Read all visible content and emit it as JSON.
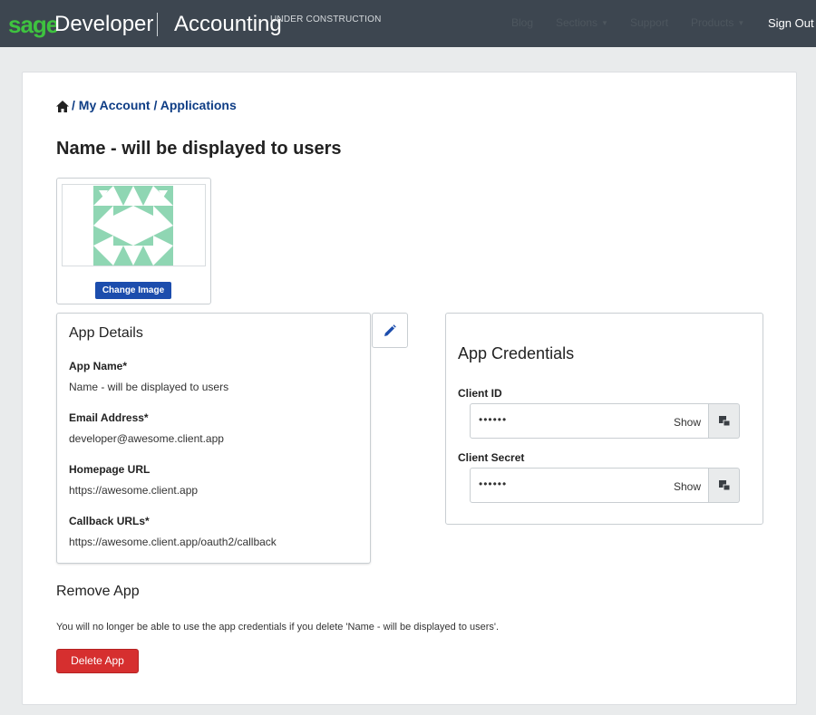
{
  "header": {
    "logo_sage": "sage",
    "logo_developer": "Developer",
    "logo_product": "Accounting",
    "logo_status": "UNDER CONSTRUCTION",
    "nav": {
      "blog": "Blog",
      "sections": "Sections",
      "support": "Support",
      "products": "Products",
      "sign_out": "Sign Out"
    }
  },
  "breadcrumb": {
    "home_icon": "home-icon",
    "text": "/ My Account / Applications"
  },
  "page_title": "Name - will be displayed to users",
  "image_panel": {
    "change_label": "Change Image",
    "identicon_color": "#8fd6b3"
  },
  "app_details": {
    "title": "App Details",
    "fields": [
      {
        "label": "App Name*",
        "value": "Name - will be displayed to users"
      },
      {
        "label": "Email Address*",
        "value": "developer@awesome.client.app"
      },
      {
        "label": "Homepage URL",
        "value": "https://awesome.client.app"
      },
      {
        "label": "Callback URLs*",
        "value": "https://awesome.client.app/oauth2/callback"
      }
    ],
    "edit_icon": "pencil-icon"
  },
  "credentials": {
    "title": "App Credentials",
    "client_id": {
      "label": "Client ID",
      "masked": "••••••",
      "show_label": "Show",
      "copy_icon": "clipboard-icon"
    },
    "client_secret": {
      "label": "Client Secret",
      "masked": "••••••",
      "show_label": "Show",
      "copy_icon": "clipboard-icon"
    }
  },
  "remove_app": {
    "title": "Remove App",
    "warning": "You will no longer be able to use the app credentials if you delete 'Name - will be displayed to users'.",
    "delete_label": "Delete App"
  },
  "colors": {
    "topbar": "#3d4650",
    "sage_green": "#3ec33f",
    "primary_blue": "#1c4dad",
    "link_blue": "#0e3d85",
    "danger_red": "#d62f2f"
  }
}
